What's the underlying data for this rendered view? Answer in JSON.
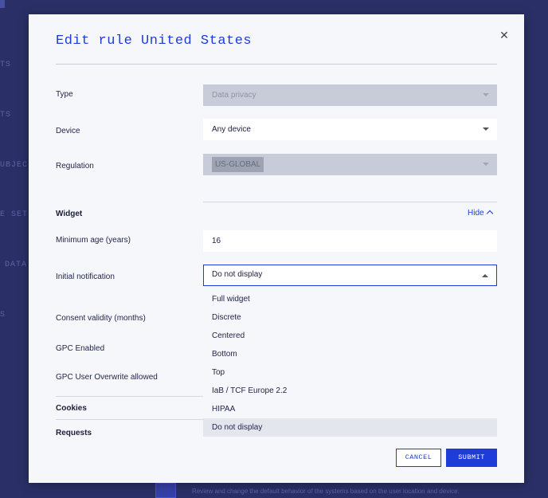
{
  "background": {
    "nav_fragments": [
      "TS",
      "TS",
      "UBJEC",
      "E SET",
      "DATA",
      "S"
    ],
    "footer_text": "Review and change the default behavior of the systems based on the user location and device."
  },
  "modal": {
    "title": "Edit rule United States",
    "close_icon": "close-icon",
    "fields": {
      "type": {
        "label": "Type",
        "value": "Data privacy"
      },
      "device": {
        "label": "Device",
        "value": "Any device"
      },
      "regulation": {
        "label": "Regulation",
        "value": "US-GLOBAL"
      }
    },
    "widget": {
      "title": "Widget",
      "toggle_label": "Hide",
      "min_age": {
        "label": "Minimum age (years)",
        "value": "16"
      },
      "initial_notification": {
        "label": "Initial notification",
        "value": "Do not display",
        "options": [
          "Full widget",
          "Discrete",
          "Centered",
          "Bottom",
          "Top",
          "IaB / TCF Europe 2.2",
          "HIPAA",
          "Do not display"
        ],
        "selected": "Do not display"
      },
      "consent_validity": {
        "label": "Consent validity (months)"
      },
      "gpc_enabled": {
        "label": "GPC Enabled"
      },
      "gpc_overwrite": {
        "label": "GPC User Overwrite allowed"
      }
    },
    "sections": {
      "cookies": "Cookies",
      "requests": "Requests"
    },
    "buttons": {
      "cancel": "CANCEL",
      "submit": "SUBMIT"
    }
  },
  "colors": {
    "accent": "#1d3cd8",
    "backdrop": "#2a3067",
    "modal_bg": "#f6f7fa"
  }
}
